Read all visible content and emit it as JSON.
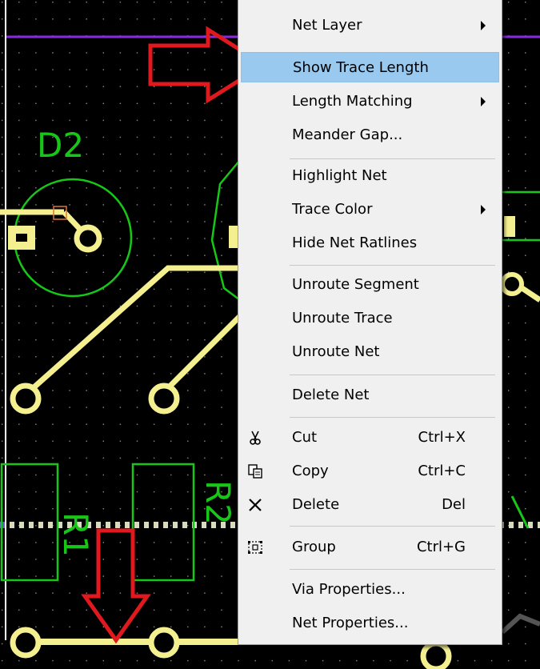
{
  "colors": {
    "background": "#000000",
    "trace": "#f5f08f",
    "silkscreen": "#17c717",
    "purple_line": "#8a2be2",
    "annotation_arrow": "#e0191e",
    "menu_bg": "#f0f0f0",
    "menu_highlight": "#99c9ef"
  },
  "pcb": {
    "component_labels": [
      "D2",
      "R1",
      "R2"
    ]
  },
  "menu": {
    "items": [
      {
        "label": "Net Layer",
        "submenu": true
      },
      {
        "label": "Show Trace Length",
        "highlighted": true
      },
      {
        "label": "Length Matching",
        "submenu": true
      },
      {
        "label": "Meander Gap..."
      },
      {
        "label": "Highlight Net"
      },
      {
        "label": "Trace Color",
        "submenu": true
      },
      {
        "label": "Hide Net Ratlines"
      },
      {
        "label": "Unroute Segment"
      },
      {
        "label": "Unroute Trace"
      },
      {
        "label": "Unroute Net"
      },
      {
        "label": "Delete Net"
      },
      {
        "label": "Cut",
        "shortcut": "Ctrl+X",
        "icon": "scissors-icon"
      },
      {
        "label": "Copy",
        "shortcut": "Ctrl+C",
        "icon": "copy-icon"
      },
      {
        "label": "Delete",
        "shortcut": "Del",
        "icon": "delete-x-icon"
      },
      {
        "label": "Group",
        "shortcut": "Ctrl+G",
        "icon": "group-icon"
      },
      {
        "label": "Via Properties..."
      },
      {
        "label": "Net Properties..."
      }
    ]
  }
}
